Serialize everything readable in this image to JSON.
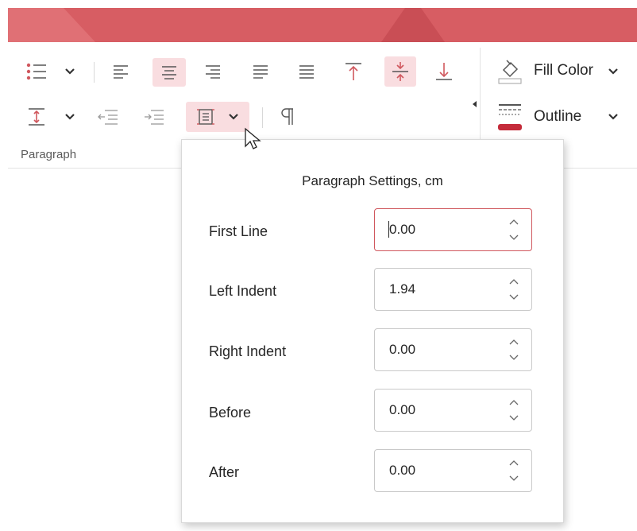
{
  "ribbon": {
    "group_label": "Paragraph",
    "fill_color_label": "Fill Color",
    "outline_label": "Outline"
  },
  "popup": {
    "title": "Paragraph Settings, cm",
    "rows": [
      {
        "label": "First Line",
        "value": "0.00"
      },
      {
        "label": "Left Indent",
        "value": "1.94"
      },
      {
        "label": "Right Indent",
        "value": "0.00"
      },
      {
        "label": "Before",
        "value": "0.00"
      },
      {
        "label": "After",
        "value": "0.00"
      }
    ]
  },
  "colors": {
    "accent": "#d0585e",
    "titlebar": "#d75d63",
    "active_bg": "#f9dde0"
  }
}
